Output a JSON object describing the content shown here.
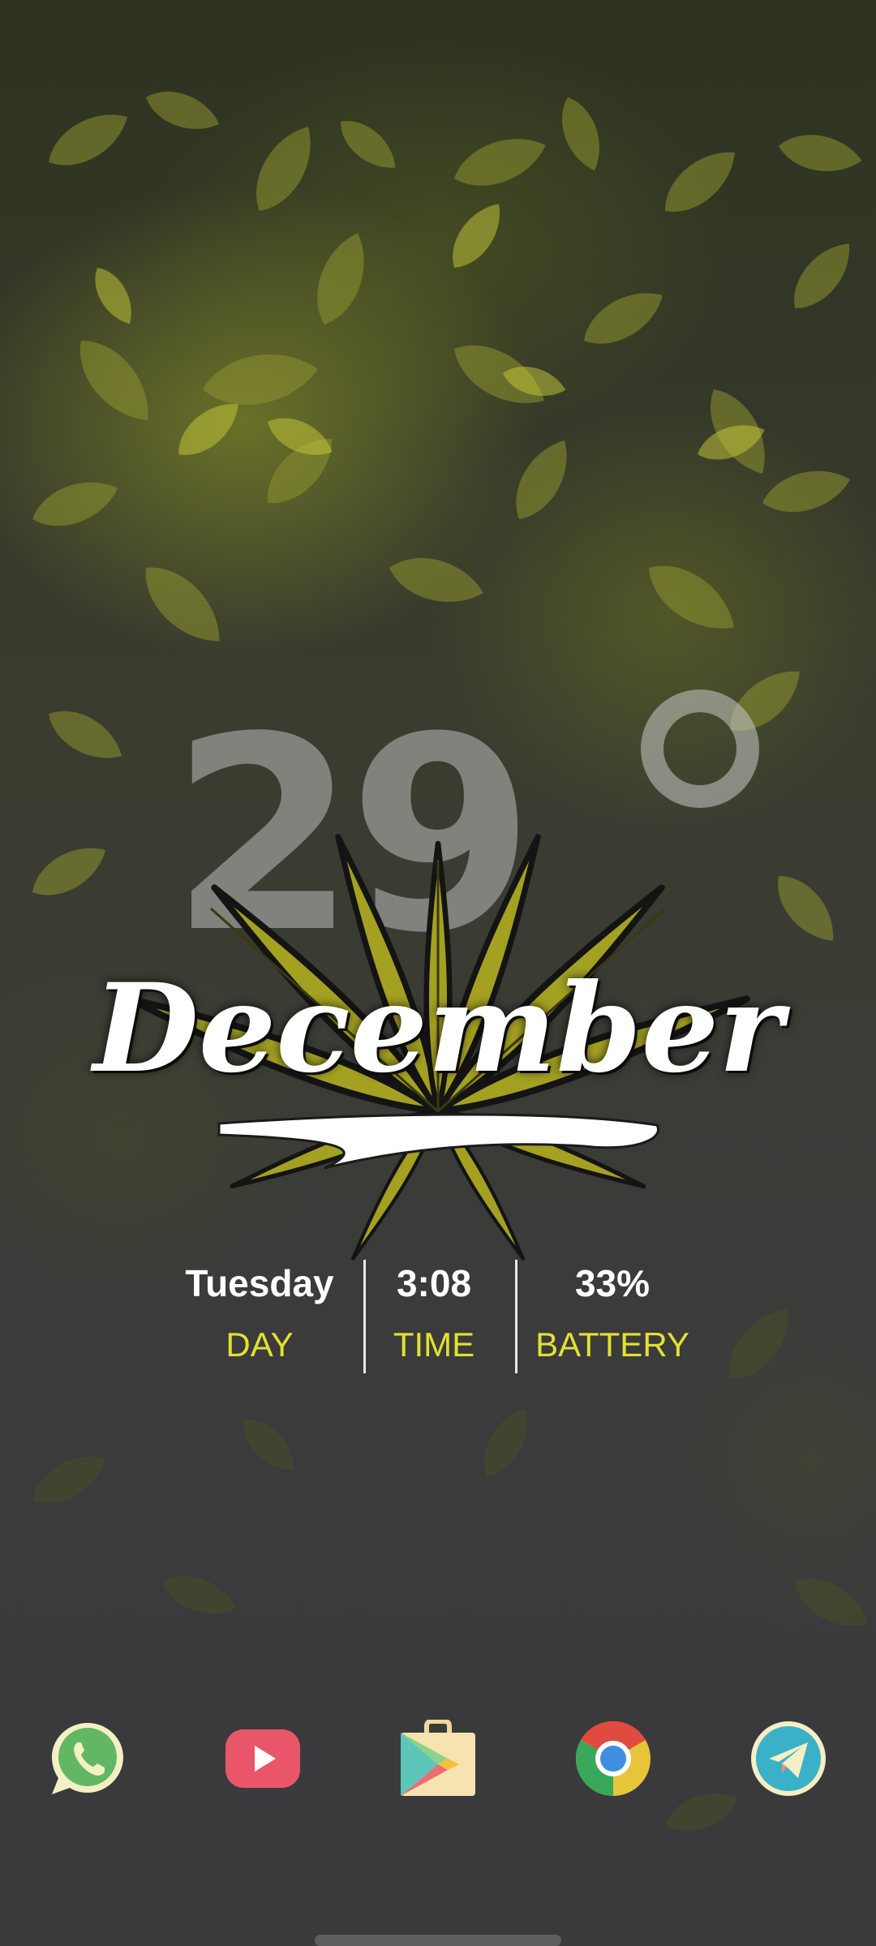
{
  "widget": {
    "temperature": "29",
    "month": "December",
    "stats": [
      {
        "value": "Tuesday",
        "label": "DAY"
      },
      {
        "value": "3:08",
        "label": "TIME"
      },
      {
        "value": "33%",
        "label": "BATTERY"
      }
    ]
  },
  "dock": {
    "apps": [
      {
        "name": "WhatsApp",
        "icon": "whatsapp-icon"
      },
      {
        "name": "YouTube",
        "icon": "youtube-icon"
      },
      {
        "name": "Play Store",
        "icon": "play-store-icon"
      },
      {
        "name": "Chrome",
        "icon": "chrome-icon"
      },
      {
        "name": "Telegram",
        "icon": "telegram-icon"
      }
    ]
  },
  "colors": {
    "accent_yellow": "#e3e032",
    "leaf_green": "#9c9a1f",
    "background": "#3b3b3d"
  }
}
